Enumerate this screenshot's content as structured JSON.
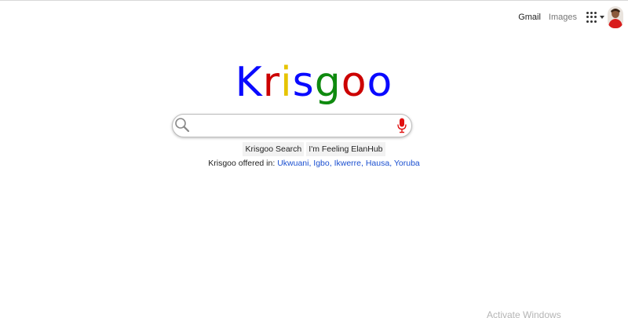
{
  "header": {
    "gmail_label": "Gmail",
    "images_label": "Images",
    "apps_icon": "apps-grid-icon",
    "avatar_icon": "user-avatar"
  },
  "logo": {
    "letters": [
      {
        "char": "K",
        "color": "#0a0aff"
      },
      {
        "char": "r",
        "color": "#cc0000"
      },
      {
        "char": "i",
        "color": "#e6c400"
      },
      {
        "char": "s",
        "color": "#0a0aff"
      },
      {
        "char": "g",
        "color": "#0f8a0f"
      },
      {
        "char": "o",
        "color": "#cc0000"
      },
      {
        "char": "o",
        "color": "#0a0aff"
      }
    ]
  },
  "search": {
    "value": "",
    "placeholder": "",
    "search_icon": "magnifier-icon",
    "mic_icon": "microphone-icon",
    "mic_color": "#e01010"
  },
  "buttons": {
    "search_label": "Krisgoo Search",
    "lucky_label": "I'm Feeling ElanHub"
  },
  "offered": {
    "prefix": "Krisgoo offered in:",
    "languages": [
      "Ukwuani,",
      "Igbo,",
      "Ikwerre,",
      "Hausa,",
      "Yoruba"
    ],
    "link_color": "#1a4fd0"
  },
  "watermark": {
    "text": "Activate Windows"
  }
}
